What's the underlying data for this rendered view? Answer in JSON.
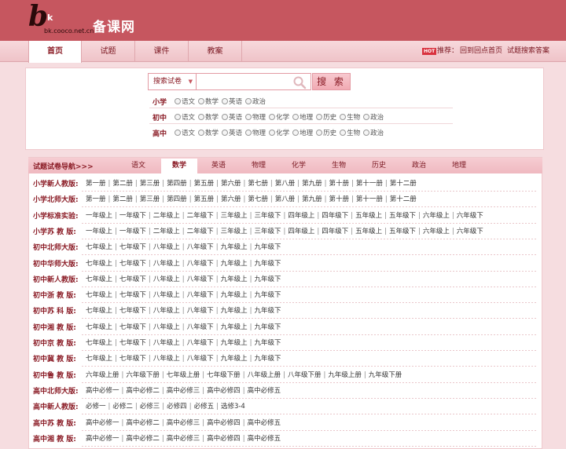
{
  "header": {
    "logo_b": "b",
    "logo_k": "k",
    "logo_url": "bk.cooco.net.cn",
    "site_name": "备课网"
  },
  "nav": {
    "tabs": [
      "首页",
      "试题",
      "课件",
      "教案"
    ],
    "hot_badge": "HOT",
    "recommend": [
      "推荐：",
      "回到回点首页",
      "试题搜索答案"
    ]
  },
  "search": {
    "select_value": "搜索试卷",
    "input_value": "",
    "button": "搜 索",
    "levels": [
      {
        "label": "小学",
        "subjects": [
          "语文",
          "数学",
          "英语",
          "政治"
        ]
      },
      {
        "label": "初中",
        "subjects": [
          "语文",
          "数学",
          "英语",
          "物理",
          "化学",
          "地理",
          "历史",
          "生物",
          "政治"
        ]
      },
      {
        "label": "高中",
        "subjects": [
          "语文",
          "数学",
          "英语",
          "物理",
          "化学",
          "地理",
          "历史",
          "生物",
          "政治"
        ]
      }
    ]
  },
  "browse": {
    "title": "试题试卷导航>>>",
    "tabs": [
      "语文",
      "数学",
      "英语",
      "物理",
      "化学",
      "生物",
      "历史",
      "政治",
      "地理"
    ],
    "active_tab": "数学",
    "rows": [
      {
        "label": "小学新人教版:",
        "links": [
          "第一册",
          "第二册",
          "第三册",
          "第四册",
          "第五册",
          "第六册",
          "第七册",
          "第八册",
          "第九册",
          "第十册",
          "第十一册",
          "第十二册"
        ]
      },
      {
        "label": "小学北师大版:",
        "links": [
          "第一册",
          "第二册",
          "第三册",
          "第四册",
          "第五册",
          "第六册",
          "第七册",
          "第八册",
          "第九册",
          "第十册",
          "第十一册",
          "第十二册"
        ]
      },
      {
        "label": "小学标准实验:",
        "links": [
          "一年级上",
          "一年级下",
          "二年级上",
          "二年级下",
          "三年级上",
          "三年级下",
          "四年级上",
          "四年级下",
          "五年级上",
          "五年级下",
          "六年级上",
          "六年级下"
        ]
      },
      {
        "label": "小学苏 教 版:",
        "links": [
          "一年级上",
          "一年级下",
          "二年级上",
          "二年级下",
          "三年级上",
          "三年级下",
          "四年级上",
          "四年级下",
          "五年级上",
          "五年级下",
          "六年级上",
          "六年级下"
        ]
      },
      {
        "label": "初中北师大版:",
        "links": [
          "七年级上",
          "七年级下",
          "八年级上",
          "八年级下",
          "九年级上",
          "九年级下"
        ]
      },
      {
        "label": "初中华师大版:",
        "links": [
          "七年级上",
          "七年级下",
          "八年级上",
          "八年级下",
          "九年级上",
          "九年级下"
        ]
      },
      {
        "label": "初中新人教版:",
        "links": [
          "七年级上",
          "七年级下",
          "八年级上",
          "八年级下",
          "九年级上",
          "九年级下"
        ]
      },
      {
        "label": "初中浙 教 版:",
        "links": [
          "七年级上",
          "七年级下",
          "八年级上",
          "八年级下",
          "九年级上",
          "九年级下"
        ]
      },
      {
        "label": "初中苏 科 版:",
        "links": [
          "七年级上",
          "七年级下",
          "八年级上",
          "八年级下",
          "九年级上",
          "九年级下"
        ]
      },
      {
        "label": "初中湘 教 版:",
        "links": [
          "七年级上",
          "七年级下",
          "八年级上",
          "八年级下",
          "九年级上",
          "九年级下"
        ]
      },
      {
        "label": "初中京 教 版:",
        "links": [
          "七年级上",
          "七年级下",
          "八年级上",
          "八年级下",
          "九年级上",
          "九年级下"
        ]
      },
      {
        "label": "初中冀 教 版:",
        "links": [
          "七年级上",
          "七年级下",
          "八年级上",
          "八年级下",
          "九年级上",
          "九年级下"
        ]
      },
      {
        "label": "初中鲁 教 版:",
        "links": [
          "六年级上册",
          "六年级下册",
          "七年级上册",
          "七年级下册",
          "八年级上册",
          "八年级下册",
          "九年级上册",
          "九年级下册"
        ]
      },
      {
        "label": "高中北师大版:",
        "links": [
          "高中必修一",
          "高中必修二",
          "高中必修三",
          "高中必修四",
          "高中必修五"
        ]
      },
      {
        "label": "高中新人教版:",
        "links": [
          "必修一",
          "必修二",
          "必修三",
          "必修四",
          "必修五",
          "选修3-4"
        ]
      },
      {
        "label": "高中苏 教 版:",
        "links": [
          "高中必修一",
          "高中必修二",
          "高中必修三",
          "高中必修四",
          "高中必修五"
        ]
      },
      {
        "label": "高中湘 教 版:",
        "links": [
          "高中必修一",
          "高中必修二",
          "高中必修三",
          "高中必修四",
          "高中必修五"
        ]
      }
    ]
  },
  "colors": {
    "brand": "#c6565f",
    "accent": "#8a1b25",
    "background": "#f6dde0"
  }
}
